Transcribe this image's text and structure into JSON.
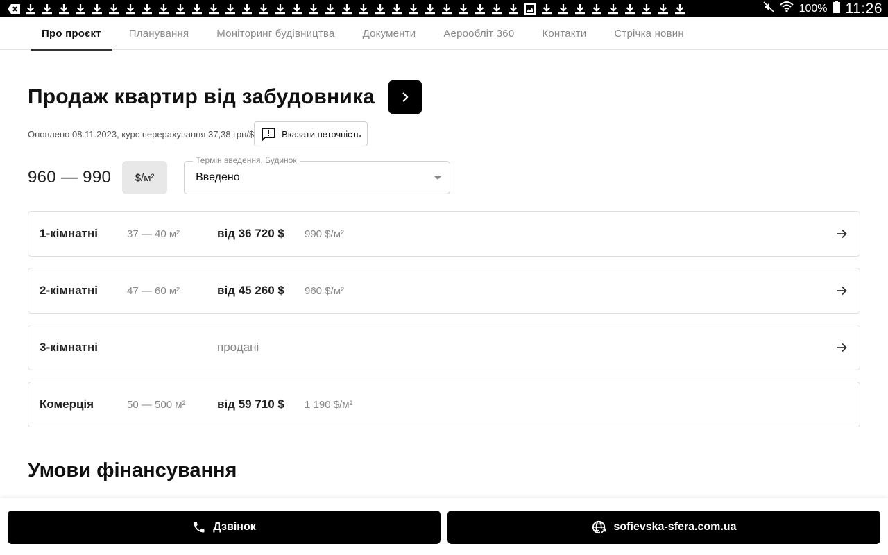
{
  "status_bar": {
    "battery_percent": "100%",
    "time": "11:26",
    "download_icons": 40
  },
  "tabs": [
    {
      "label": "Про проєкт",
      "active": true
    },
    {
      "label": "Планування",
      "active": false
    },
    {
      "label": "Моніторинг будівництва",
      "active": false
    },
    {
      "label": "Документи",
      "active": false
    },
    {
      "label": "Аерообліт 360",
      "active": false
    },
    {
      "label": "Контакти",
      "active": false
    },
    {
      "label": "Стрічка новин",
      "active": false
    }
  ],
  "header": {
    "title": "Продаж квартир від забудовника",
    "updated_text": "Оновлено 08.11.2023, курс перерахування 37,38 грн/$",
    "report_label": "Вказати неточність"
  },
  "price": {
    "range": "960 — 990",
    "unit": "$/м²",
    "select_label": "Термін введення, Будинок",
    "select_value": "Введено"
  },
  "apartments": [
    {
      "name": "1-кімнатні",
      "area": "37 — 40 м²",
      "price": "від 36 720 $",
      "ppm": "990 $/м²",
      "sold": ""
    },
    {
      "name": "2-кімнатні",
      "area": "47 — 60 м²",
      "price": "від 45 260 $",
      "ppm": "960 $/м²",
      "sold": ""
    },
    {
      "name": "3-кімнатні",
      "area": "",
      "price": "",
      "ppm": "",
      "sold": "продані"
    },
    {
      "name": "Комерція",
      "area": "50 — 500 м²",
      "price": "від 59 710 $",
      "ppm": "1 190 $/м²",
      "sold": ""
    }
  ],
  "financing": {
    "title": "Умови фінансування"
  },
  "bottom": {
    "call_label": "Дзвінок",
    "site_label": "sofievska-sfera.com.ua"
  }
}
